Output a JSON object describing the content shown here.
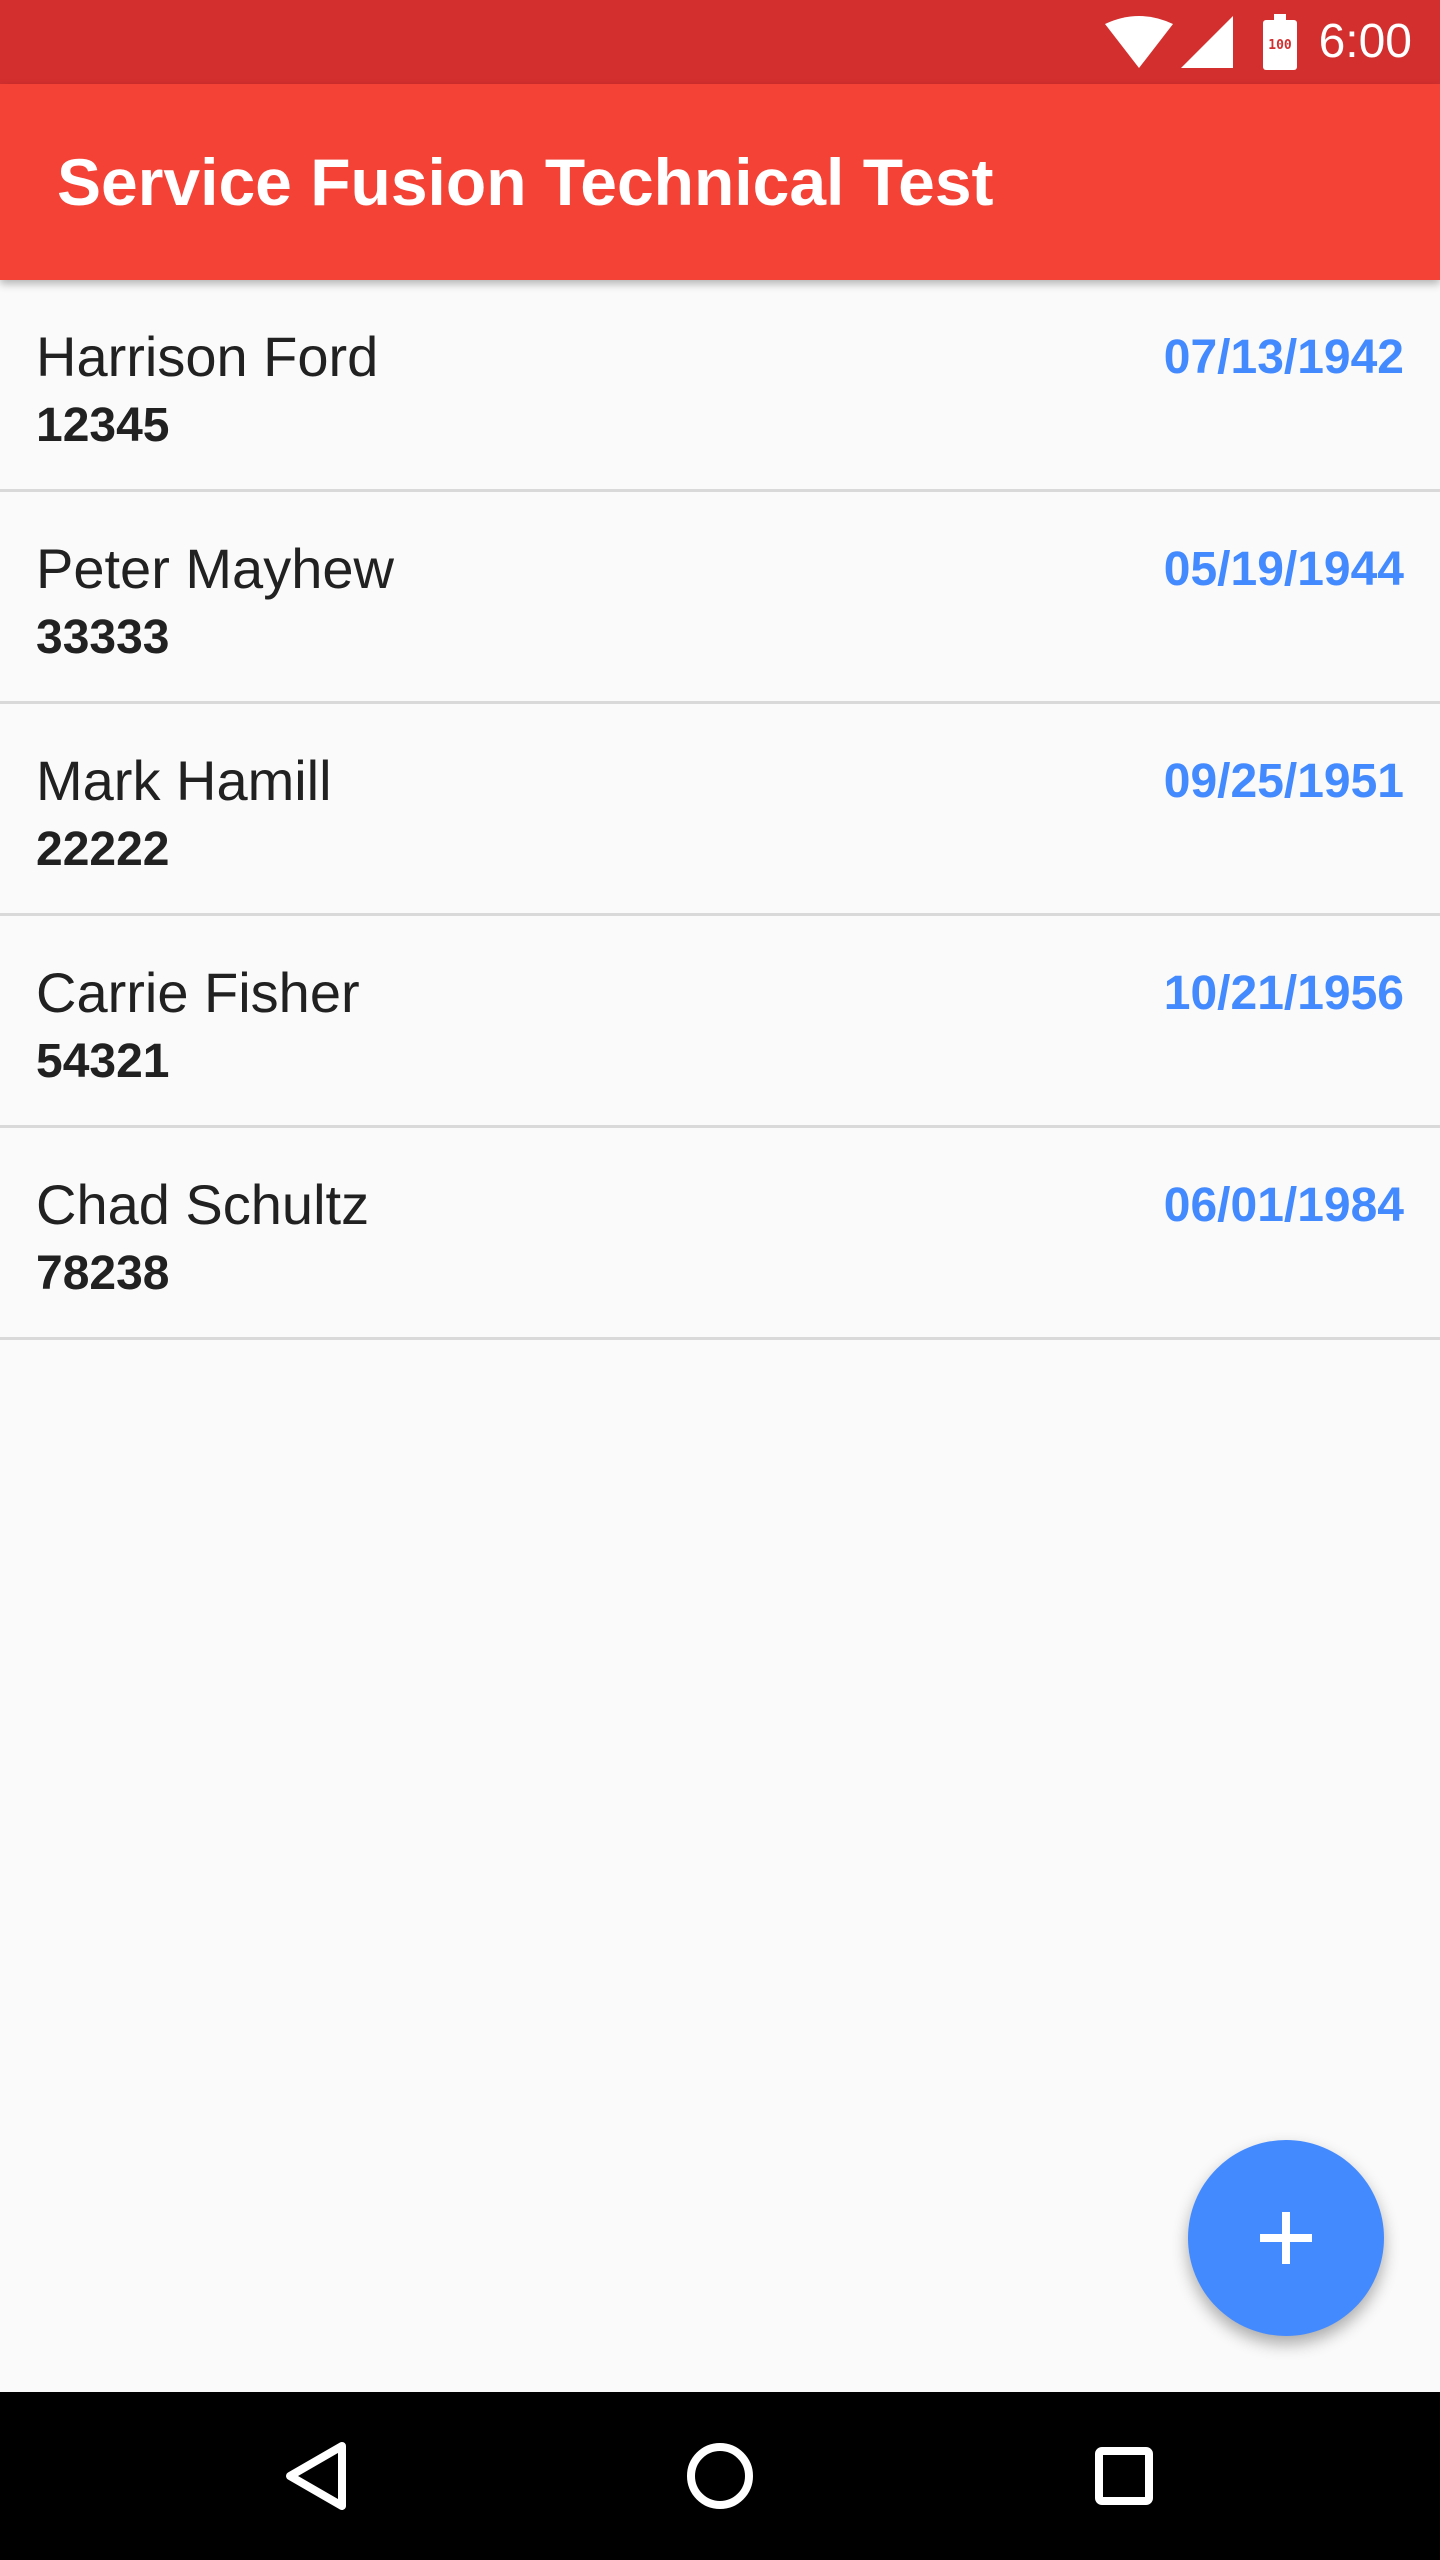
{
  "status_bar": {
    "time": "6:00",
    "battery_level": "100",
    "color": "#d32f2f",
    "icons": [
      "wifi-icon",
      "signal-icon",
      "battery-icon"
    ]
  },
  "app_bar": {
    "title": "Service Fusion Technical Test",
    "color": "#f44336"
  },
  "people": [
    {
      "name": "Harrison Ford",
      "id": "12345",
      "date": "07/13/1942"
    },
    {
      "name": "Peter Mayhew",
      "id": "33333",
      "date": "05/19/1944"
    },
    {
      "name": "Mark Hamill",
      "id": "22222",
      "date": "09/25/1951"
    },
    {
      "name": "Carrie Fisher",
      "id": "54321",
      "date": "10/21/1956"
    },
    {
      "name": "Chad Schultz",
      "id": "78238",
      "date": "06/01/1984"
    }
  ],
  "fab": {
    "icon": "plus-icon",
    "color": "#448aff"
  },
  "nav_bar": {
    "icons": [
      "back-icon",
      "home-icon",
      "recents-icon"
    ]
  },
  "colors": {
    "date_text": "#448aff",
    "background": "#fafafa"
  }
}
